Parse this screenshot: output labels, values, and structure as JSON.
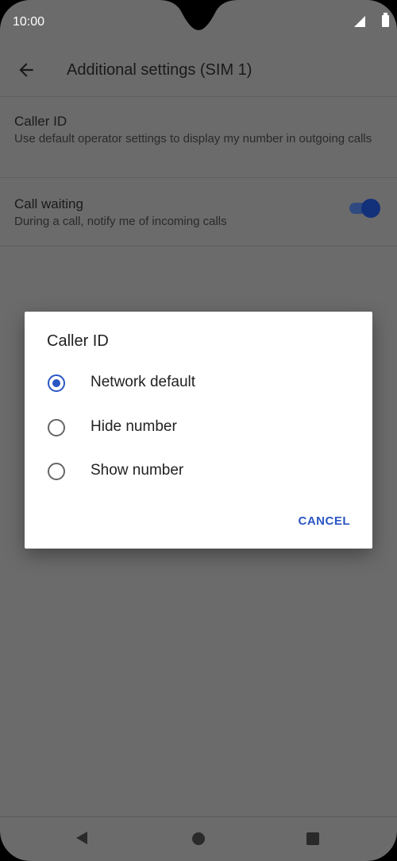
{
  "status": {
    "time": "10:00"
  },
  "appbar": {
    "title": "Additional settings (SIM 1)",
    "back_icon": "arrow-left-icon"
  },
  "settings": [
    {
      "title": "Caller ID",
      "subtitle": "Use default operator settings to display my number in outgoing calls"
    },
    {
      "title": "Call waiting",
      "subtitle": "During a call, notify me of incoming calls",
      "toggle_on": true
    }
  ],
  "dialog": {
    "title": "Caller ID",
    "options": [
      {
        "label": "Network default",
        "selected": true
      },
      {
        "label": "Hide number",
        "selected": false
      },
      {
        "label": "Show number",
        "selected": false
      }
    ],
    "cancel_label": "CANCEL"
  },
  "colors": {
    "accent": "#2b56c4",
    "scrim": "#6b6b6b"
  }
}
